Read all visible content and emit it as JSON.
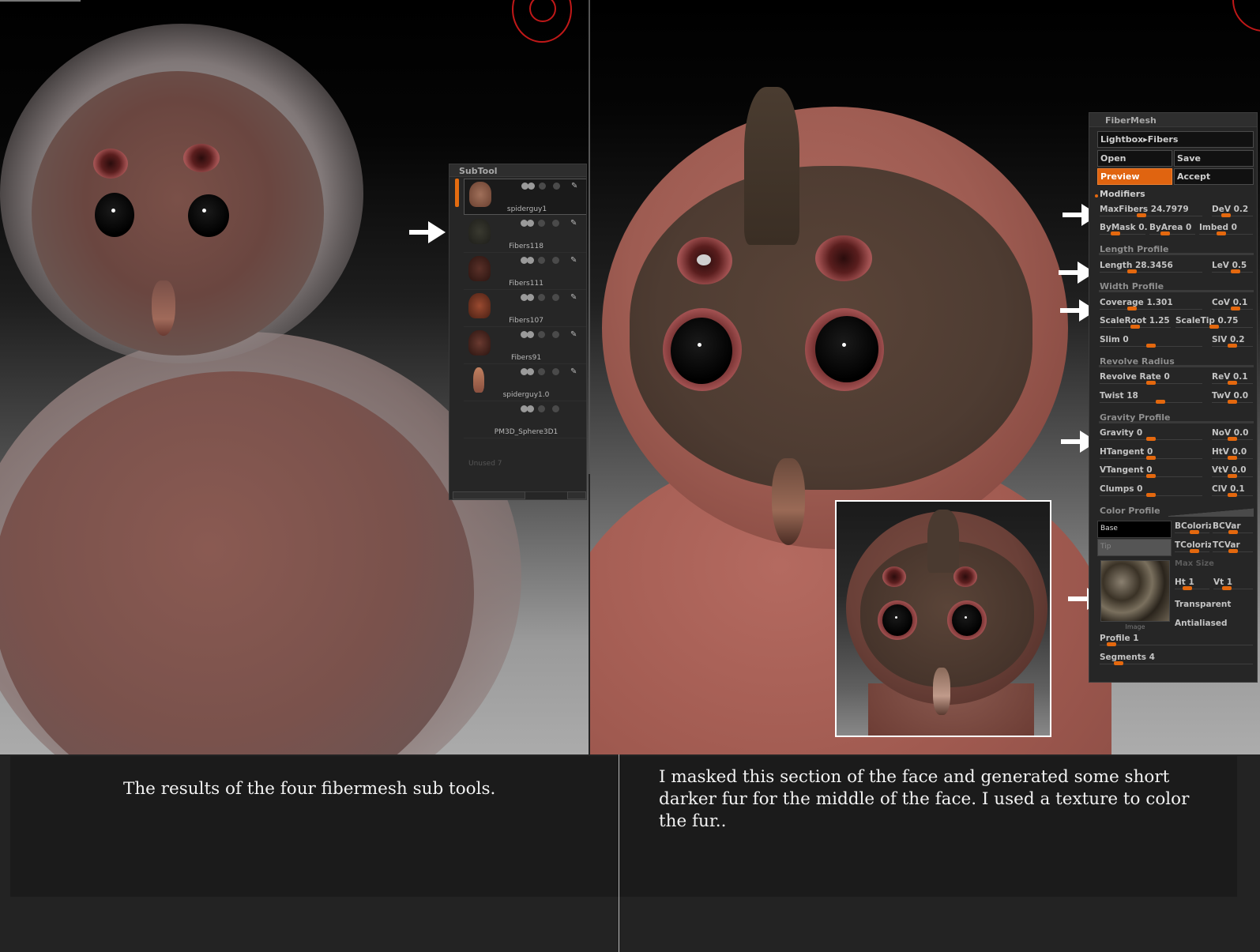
{
  "subtool": {
    "title": "SubTool",
    "items": [
      {
        "label": "spiderguy1"
      },
      {
        "label": "Fibers118"
      },
      {
        "label": "Fibers111"
      },
      {
        "label": "Fibers107"
      },
      {
        "label": "Fibers91"
      },
      {
        "label": "spiderguy1.0"
      },
      {
        "label": "PM3D_Sphere3D1"
      }
    ],
    "unused_label": "Unused 7"
  },
  "fibermesh": {
    "title": "FiberMesh",
    "lightbox_label": "Lightbox▸Fibers",
    "open_label": "Open",
    "save_label": "Save",
    "preview_label": "Preview",
    "accept_label": "Accept",
    "modifiers_label": "Modifiers",
    "maxfibers": "MaxFibers 24.7979",
    "dev": "DeV 0.2",
    "bymask": "ByMask 0.",
    "byarea": "ByArea 0",
    "imbed": "Imbed 0",
    "length_profile": "Length Profile",
    "length": "Length 28.3456",
    "lev": "LeV 0.5",
    "width_profile": "Width Profile",
    "coverage": "Coverage 1.301",
    "cov": "CoV 0.1",
    "scaleroot": "ScaleRoot 1.25",
    "scaletip": "ScaleTip 0.75",
    "slim": "Slim 0",
    "slv": "SlV 0.2",
    "revolve_radius": "Revolve Radius",
    "revolve_rate": "Revolve Rate 0",
    "rev": "ReV 0.1",
    "twist": "Twist 18",
    "twv": "TwV 0.0",
    "gravity_profile": "Gravity Profile",
    "gravity": "Gravity 0",
    "nov": "NoV 0.0",
    "htangent": "HTangent 0",
    "htv": "HtV 0.0",
    "vtangent": "VTangent 0",
    "vtv": "VtV 0.0",
    "clumps": "Clumps 0",
    "clv": "ClV 0.1",
    "color_profile": "Color Profile",
    "base_label": "Base",
    "tip_label": "Tip",
    "bcolorize": "BColoriz",
    "bcvar": "BCVar",
    "tcolorize": "TColoriz",
    "tcvar": "TCVar",
    "max_size": "Max Size",
    "image_label": "Image",
    "ht": "Ht 1",
    "vt": "Vt 1",
    "transparent": "Transparent",
    "antialiased": "Antialiased",
    "profile": "Profile 1",
    "segments": "Segments 4",
    "slider_levels": {
      "maxfibers": 0.4,
      "dev": 0.3,
      "bymask": 0.3,
      "byarea": 0.3,
      "imbed": 0.4,
      "length": 0.3,
      "lev": 0.6,
      "coverage": 0.3,
      "cov": 0.6,
      "scaleroot": 0.5,
      "scaletip": 0.5,
      "slim": 0.5,
      "slv": 0.5,
      "revolve_rate": 0.5,
      "rev": 0.5,
      "twist": 0.6,
      "twv": 0.5,
      "gravity": 0.5,
      "nov": 0.5,
      "htangent": 0.5,
      "htv": 0.5,
      "vtangent": 0.5,
      "vtv": 0.5,
      "clumps": 0.5,
      "clv": 0.5,
      "bcolorize": 0.6,
      "bcvar": 0.5,
      "tcolorize": 0.6,
      "tcvar": 0.5,
      "ht": 0.3,
      "vt": 0.3,
      "profile": 0.05,
      "segments": 0.1
    }
  },
  "captions": {
    "left": "The results of the four fibermesh sub tools.",
    "right": "I masked this section of the face and generated some short darker fur for the middle of the face. I used a texture to color the fur.."
  },
  "colors": {
    "accent": "#e4680e",
    "panel_bg": "#262626",
    "caption_bg": "#1b1b1b"
  }
}
